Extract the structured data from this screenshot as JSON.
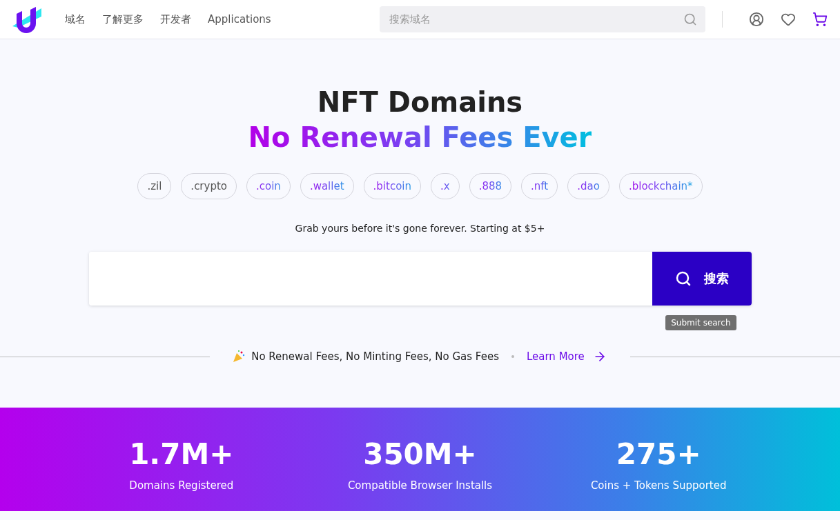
{
  "nav": {
    "links": [
      {
        "label": "域名"
      },
      {
        "label": "了解更多"
      },
      {
        "label": "开发者"
      },
      {
        "label": "Applications"
      }
    ],
    "search": {
      "placeholder": "搜索域名"
    }
  },
  "hero": {
    "title": "NFT Domains",
    "subtitle": "No Renewal Fees Ever",
    "tlds": [
      {
        "label": ".zil",
        "kind": "plain"
      },
      {
        "label": ".crypto",
        "kind": "plain"
      },
      {
        "label": ".coin",
        "kind": "gradient"
      },
      {
        "label": ".wallet",
        "kind": "gradient"
      },
      {
        "label": ".bitcoin",
        "kind": "gradient"
      },
      {
        "label": ".x",
        "kind": "gradient"
      },
      {
        "label": ".888",
        "kind": "gradient"
      },
      {
        "label": ".nft",
        "kind": "gradient"
      },
      {
        "label": ".dao",
        "kind": "gradient"
      },
      {
        "label": ".blockchain*",
        "kind": "gradient"
      }
    ],
    "tagline": "Grab yours before it's gone forever. Starting at $5+",
    "search_button": "搜索",
    "tooltip": "Submit search",
    "banner": {
      "text": "No Renewal Fees, No Minting Fees, No Gas Fees",
      "link": "Learn More"
    }
  },
  "stats": [
    {
      "value": "1.7M+",
      "label": "Domains Registered"
    },
    {
      "value": "350M+",
      "label": "Compatible Browser Installs"
    },
    {
      "value": "275+",
      "label": "Coins + Tokens Supported"
    }
  ]
}
